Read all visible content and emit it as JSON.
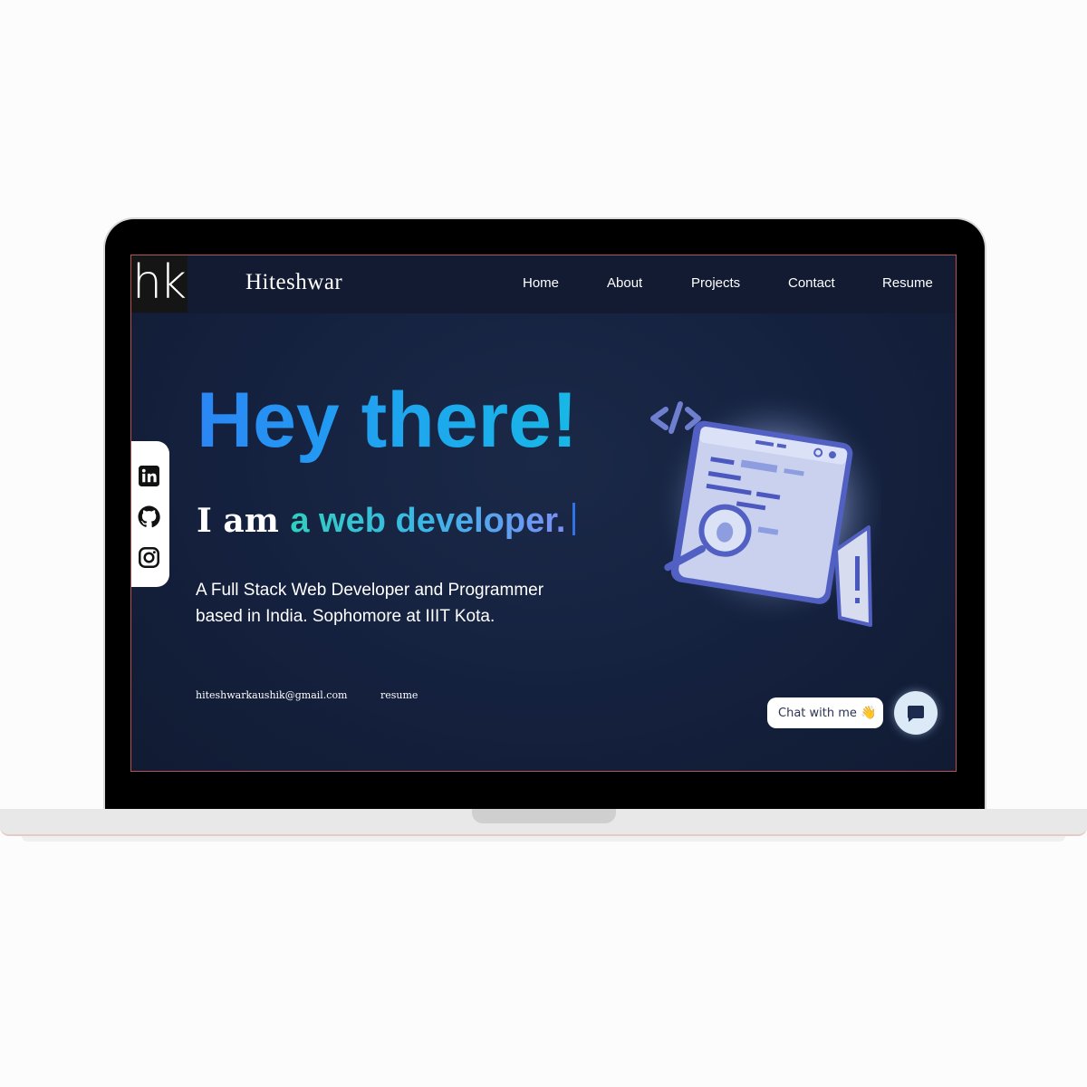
{
  "brand": {
    "logo_text": "hk",
    "name": "Hiteshwar"
  },
  "nav": {
    "items": [
      {
        "label": "Home"
      },
      {
        "label": "About"
      },
      {
        "label": "Projects"
      },
      {
        "label": "Contact"
      },
      {
        "label": "Resume"
      }
    ]
  },
  "social": {
    "icons": [
      "linkedin-icon",
      "github-icon",
      "instagram-icon"
    ]
  },
  "hero": {
    "title": "Hey there!",
    "subtitle_prefix": "I am ",
    "subtitle_role": "a web developer.",
    "description": "A Full Stack Web Developer and Programmer based in India. Sophomore at IIIT Kota."
  },
  "footer": {
    "email": "hiteshwarkaushik@gmail.com",
    "resume": "resume"
  },
  "chat": {
    "label": "Chat with me",
    "emoji": "👋"
  },
  "colors": {
    "screen_bg": "#152240",
    "navbar_bg": "#121b31",
    "title_gradient_start": "#2a86f5",
    "title_gradient_end": "#17b8e6",
    "role_gradient_start": "#30cfc0",
    "role_gradient_end": "#7b8ff6",
    "chat_button_bg": "#dce9f6"
  }
}
